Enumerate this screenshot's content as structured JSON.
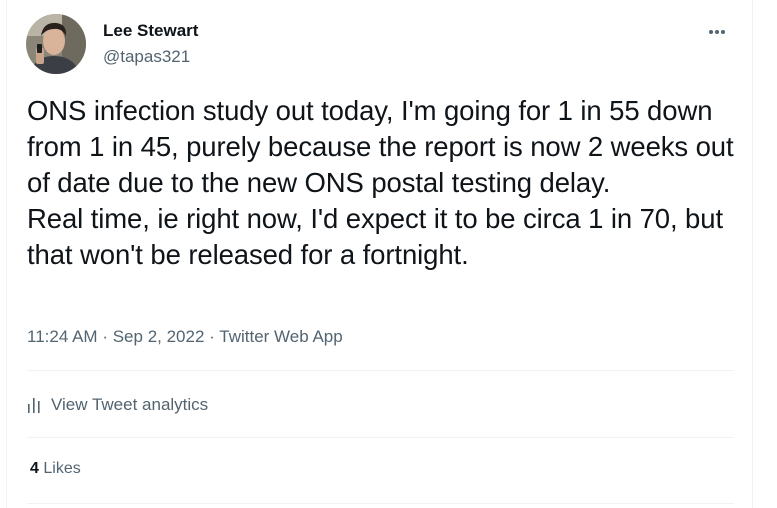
{
  "tweet": {
    "author": {
      "display_name": "Lee Stewart",
      "handle": "@tapas321"
    },
    "more_icon": "more-horizontal-icon",
    "text": "ONS infection study out today, I'm going for 1 in 55 down from 1 in 45, purely because the report is now 2 weeks out of date due to the new ONS postal testing delay.\nReal time, ie right now, I'd expect it to be circa 1 in 70, but that won't be released for a fortnight.",
    "time": "11:24 AM",
    "separator": "·",
    "date": "Sep 2, 2022",
    "source": "Twitter Web App",
    "analytics": {
      "icon": "bar-chart-icon",
      "label": "View Tweet analytics"
    },
    "likes": {
      "count": "4",
      "label": "Likes"
    }
  },
  "colors": {
    "text_primary": "#0f1419",
    "text_secondary": "#536471",
    "divider": "#eff3f4"
  }
}
